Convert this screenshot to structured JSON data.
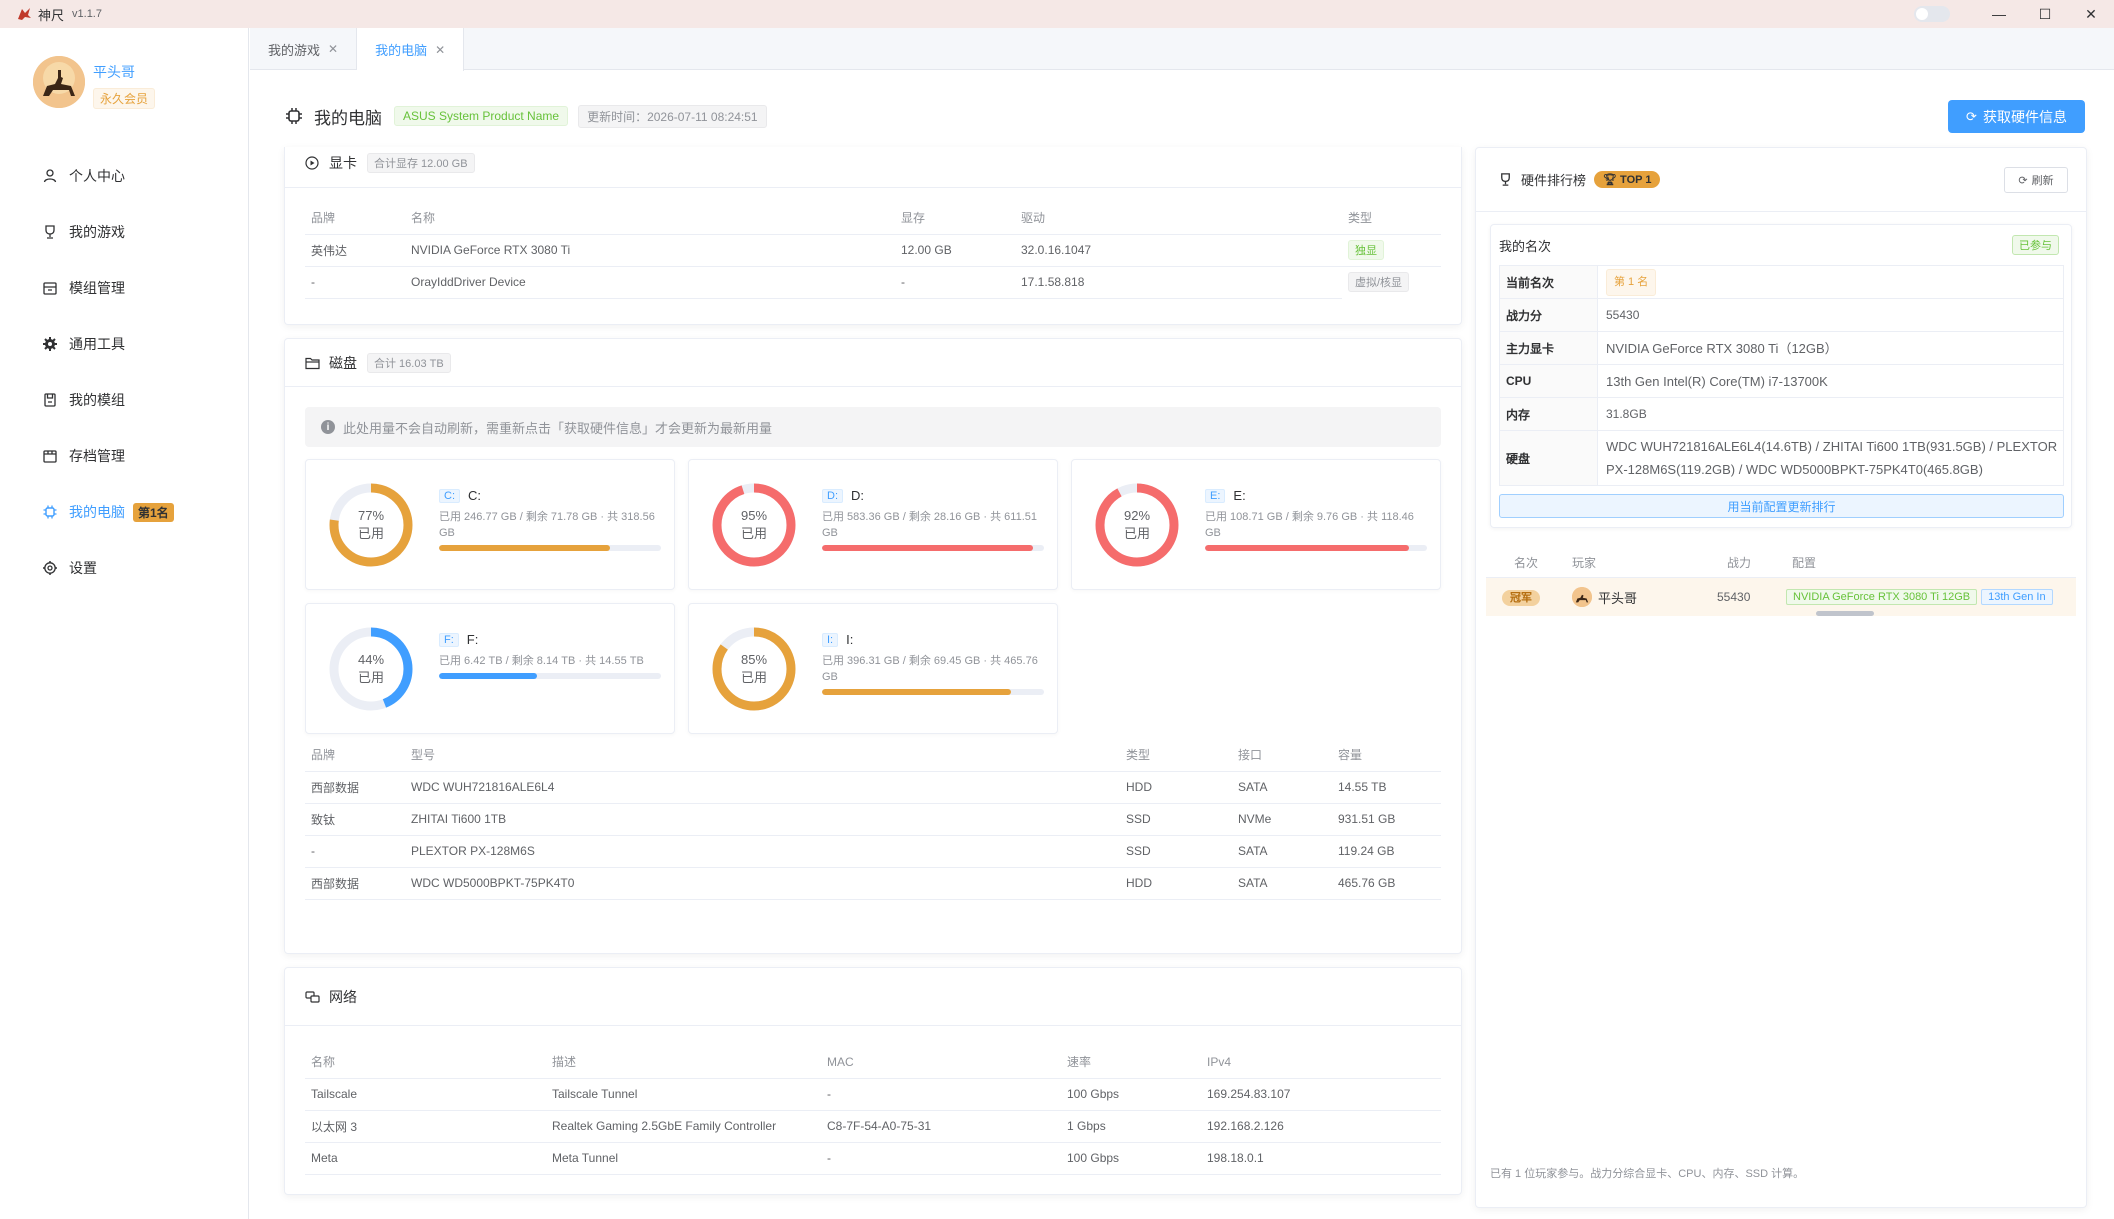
{
  "app": {
    "name": "神尺",
    "version": "v1.1.7"
  },
  "user": {
    "name": "平头哥",
    "membership": "永久会员"
  },
  "nav": [
    {
      "label": "个人中心",
      "icon": "user-icon",
      "active": false
    },
    {
      "label": "我的游戏",
      "icon": "trophy-icon",
      "active": false
    },
    {
      "label": "模组管理",
      "icon": "package-icon",
      "active": false
    },
    {
      "label": "通用工具",
      "icon": "gear-icon",
      "active": false
    },
    {
      "label": "我的模组",
      "icon": "save-icon",
      "active": false
    },
    {
      "label": "存档管理",
      "icon": "archive-icon",
      "active": false
    },
    {
      "label": "我的电脑",
      "icon": "cpu-icon",
      "active": true,
      "badge": "第1名"
    },
    {
      "label": "设置",
      "icon": "settings-icon",
      "active": false
    }
  ],
  "tabs": [
    {
      "label": "我的游戏",
      "close": "✕",
      "active": false
    },
    {
      "label": "我的电脑",
      "close": "✕",
      "active": true
    }
  ],
  "page": {
    "title": "我的电脑",
    "product": "ASUS System Product Name",
    "updated": "更新时间：2026-07-11 08:24:51",
    "fetch_button": "获取硬件信息"
  },
  "gpu": {
    "title": "显卡",
    "total": "合计显存 12.00 GB",
    "columns": [
      "品牌",
      "名称",
      "显存",
      "驱动",
      "类型"
    ],
    "rows": [
      {
        "brand": "英伟达",
        "name": "NVIDIA GeForce RTX 3080 Ti",
        "vram": "12.00 GB",
        "driver": "32.0.16.1047",
        "type": "独显"
      },
      {
        "brand": "-",
        "name": "OrayIddDriver Device",
        "vram": "-",
        "driver": "17.1.58.818",
        "type": "虚拟/核显"
      }
    ]
  },
  "disk": {
    "title": "磁盘",
    "total": "合计 16.03 TB",
    "notice": "此处用量不会自动刷新，需重新点击「获取硬件信息」才会更新为最新用量",
    "used_label": "已用",
    "drives": [
      {
        "letter": "C:",
        "name": "C:",
        "percent": 77,
        "percent_label": "77%",
        "usage": "已用 246.77 GB / 剩余 71.78 GB · 共 318.56 GB",
        "color": "#e6a23c"
      },
      {
        "letter": "D:",
        "name": "D:",
        "percent": 95,
        "percent_label": "95%",
        "usage": "已用 583.36 GB / 剩余 28.16 GB · 共 611.51 GB",
        "color": "#f56c6c"
      },
      {
        "letter": "E:",
        "name": "E:",
        "percent": 92,
        "percent_label": "92%",
        "usage": "已用 108.71 GB / 剩余 9.76 GB · 共 118.46 GB",
        "color": "#f56c6c"
      },
      {
        "letter": "F:",
        "name": "F:",
        "percent": 44,
        "percent_label": "44%",
        "usage": "已用 6.42 TB / 剩余 8.14 TB · 共 14.55 TB",
        "color": "#409eff"
      },
      {
        "letter": "I:",
        "name": "I:",
        "percent": 85,
        "percent_label": "85%",
        "usage": "已用 396.31 GB / 剩余 69.45 GB · 共 465.76 GB",
        "color": "#e6a23c"
      }
    ],
    "columns": [
      "品牌",
      "型号",
      "类型",
      "接口",
      "容量"
    ],
    "rows": [
      {
        "brand": "西部数据",
        "model": "WDC WUH721816ALE6L4",
        "type": "HDD",
        "iface": "SATA",
        "cap": "14.55 TB"
      },
      {
        "brand": "致钛",
        "model": "ZHITAI Ti600 1TB",
        "type": "SSD",
        "iface": "NVMe",
        "cap": "931.51 GB"
      },
      {
        "brand": "-",
        "model": "PLEXTOR PX-128M6S",
        "type": "SSD",
        "iface": "SATA",
        "cap": "119.24 GB"
      },
      {
        "brand": "西部数据",
        "model": "WDC WD5000BPKT-75PK4T0",
        "type": "HDD",
        "iface": "SATA",
        "cap": "465.76 GB"
      }
    ]
  },
  "network": {
    "title": "网络",
    "columns": [
      "名称",
      "描述",
      "MAC",
      "速率",
      "IPv4"
    ],
    "rows": [
      {
        "name": "Tailscale",
        "desc": "Tailscale Tunnel",
        "mac": "-",
        "speed": "100 Gbps",
        "ip": "169.254.83.107"
      },
      {
        "name": "以太网 3",
        "desc": "Realtek Gaming 2.5GbE Family Controller",
        "mac": "C8-7F-54-A0-75-31",
        "speed": "1 Gbps",
        "ip": "192.168.2.126"
      },
      {
        "name": "Meta",
        "desc": "Meta Tunnel",
        "mac": "-",
        "speed": "100 Gbps",
        "ip": "198.18.0.1"
      }
    ]
  },
  "ranking": {
    "title": "硬件排行榜",
    "top_tag": "TOP 1",
    "refresh": "刷新",
    "my_rank_title": "我的名次",
    "joined": "已参与",
    "fields": [
      {
        "key": "当前名次",
        "value": "第 1 名",
        "tag": true
      },
      {
        "key": "战力分",
        "value": "55430"
      },
      {
        "key": "主力显卡",
        "value": "NVIDIA GeForce RTX 3080 Ti（12GB）"
      },
      {
        "key": "CPU",
        "value": "13th Gen Intel(R) Core(TM) i7-13700K"
      },
      {
        "key": "内存",
        "value": "31.8GB"
      },
      {
        "key": "硬盘",
        "value": "WDC WUH721816ALE6L4(14.6TB) / ZHITAI Ti600 1TB(931.5GB) / PLEXTOR PX-128M6S(119.2GB) / WDC WD5000BPKT-75PK4T0(465.8GB)"
      }
    ],
    "update_button": "用当前配置更新排行",
    "board_columns": [
      "名次",
      "玩家",
      "战力",
      "配置"
    ],
    "board_rows": [
      {
        "rank": "冠军",
        "player": "平头哥",
        "score": "55430",
        "cfg_gpu": "NVIDIA GeForce RTX 3080 Ti 12GB",
        "cfg_cpu": "13th Gen In"
      }
    ],
    "footer": "已有 1 位玩家参与。战力分综合显卡、CPU、内存、SSD 计算。"
  },
  "colors": {
    "primary": "#409eff",
    "warning": "#e6a23c",
    "danger": "#f56c6c",
    "success": "#67c23a"
  }
}
